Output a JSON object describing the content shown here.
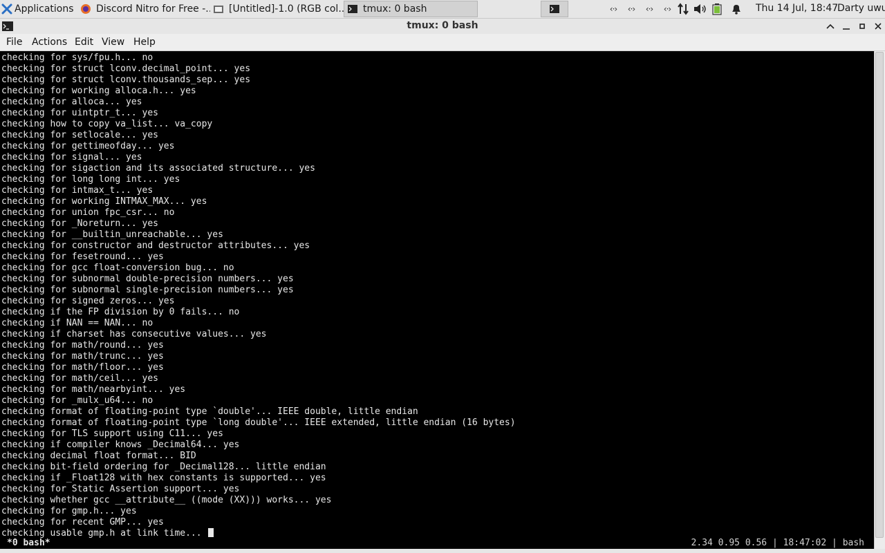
{
  "panel": {
    "applications_label": "Applications",
    "tasks": [
      {
        "label": "Discord Nitro for Free -...",
        "icon": "firefox-icon"
      },
      {
        "label": "[Untitled]-1.0 (RGB col...",
        "icon": "gimp-icon"
      },
      {
        "label": "tmux: 0 bash",
        "icon": "terminal-icon",
        "active": true
      }
    ],
    "clock": "Thu 14 Jul, 18:47",
    "user": "Darty uwu",
    "network_glyph": "‹·›"
  },
  "window": {
    "title": "tmux: 0 bash"
  },
  "menu": {
    "file": "File",
    "actions": "Actions",
    "edit": "Edit",
    "view": "View",
    "help": "Help"
  },
  "terminal": {
    "lines": [
      "checking for sys/fpu.h... no",
      "checking for struct lconv.decimal_point... yes",
      "checking for struct lconv.thousands_sep... yes",
      "checking for working alloca.h... yes",
      "checking for alloca... yes",
      "checking for uintptr_t... yes",
      "checking how to copy va_list... va_copy",
      "checking for setlocale... yes",
      "checking for gettimeofday... yes",
      "checking for signal... yes",
      "checking for sigaction and its associated structure... yes",
      "checking for long long int... yes",
      "checking for intmax_t... yes",
      "checking for working INTMAX_MAX... yes",
      "checking for union fpc_csr... no",
      "checking for _Noreturn... yes",
      "checking for __builtin_unreachable... yes",
      "checking for constructor and destructor attributes... yes",
      "checking for fesetround... yes",
      "checking for gcc float-conversion bug... no",
      "checking for subnormal double-precision numbers... yes",
      "checking for subnormal single-precision numbers... yes",
      "checking for signed zeros... yes",
      "checking if the FP division by 0 fails... no",
      "checking if NAN == NAN... no",
      "checking if charset has consecutive values... yes",
      "checking for math/round... yes",
      "checking for math/trunc... yes",
      "checking for math/floor... yes",
      "checking for math/ceil... yes",
      "checking for math/nearbyint... yes",
      "checking for _mulx_u64... no",
      "checking format of floating-point type `double'... IEEE double, little endian",
      "checking format of floating-point type `long double'... IEEE extended, little endian (16 bytes)",
      "checking for TLS support using C11... yes",
      "checking if compiler knows _Decimal64... yes",
      "checking decimal float format... BID",
      "checking bit-field ordering for _Decimal128... little endian",
      "checking if _Float128 with hex constants is supported... yes",
      "checking for Static Assertion support... yes",
      "checking whether gcc __attribute__ ((mode (XX))) works... yes",
      "checking for gmp.h... yes",
      "checking for recent GMP... yes",
      "checking usable gmp.h at link time... "
    ]
  },
  "status": {
    "left": "*0 bash*",
    "right": "2.34 0.95 0.56 | 18:47:02 | bash"
  }
}
